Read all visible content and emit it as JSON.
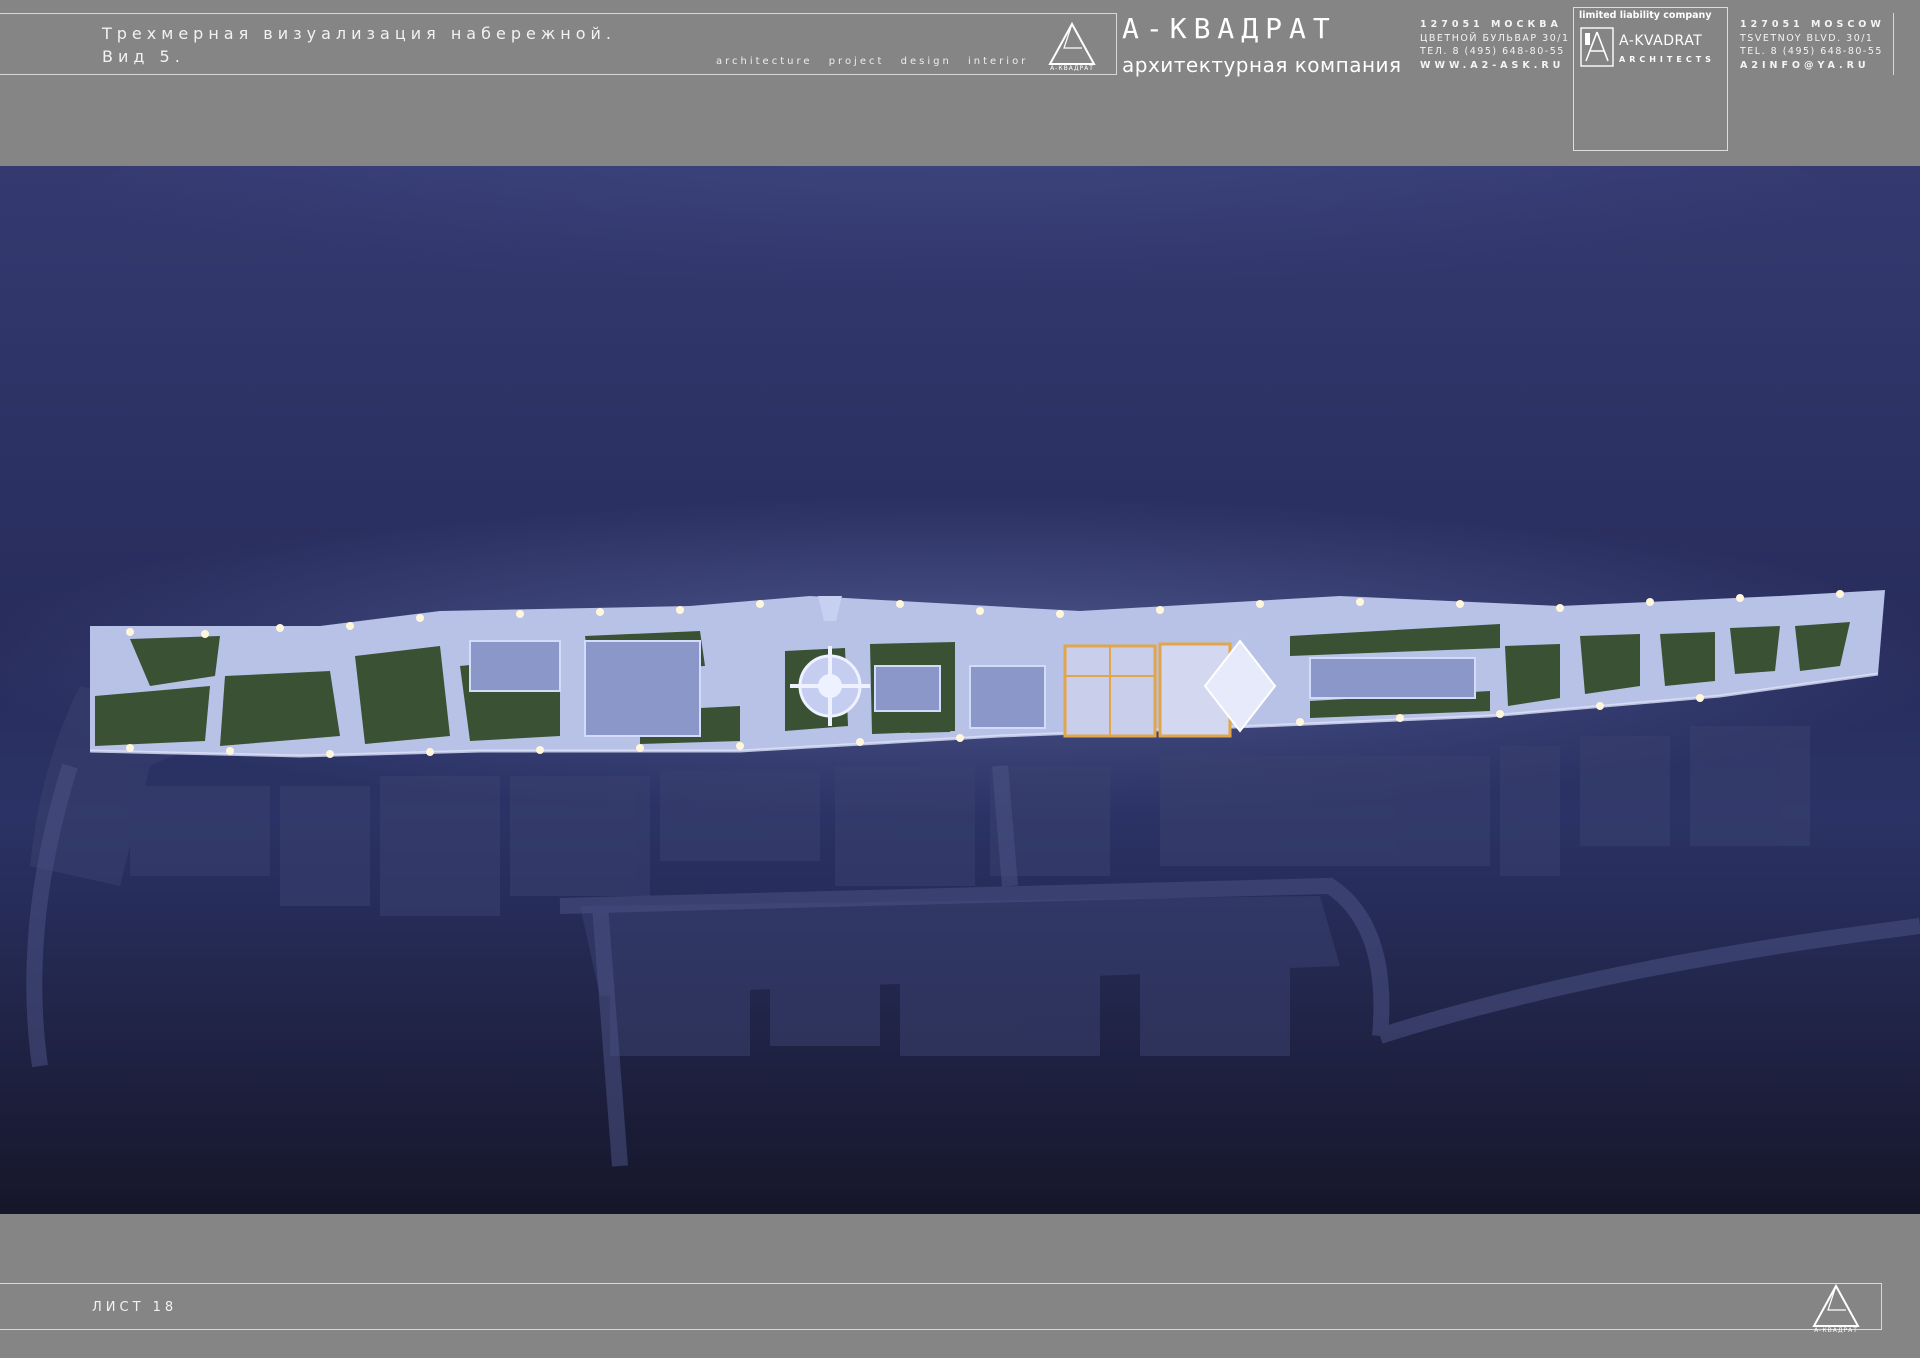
{
  "header": {
    "title_lines": [
      "Трехмерная визуализация набережной.",
      "Вид 5."
    ],
    "services": [
      "architecture",
      "project",
      "design",
      "interior"
    ],
    "logo_caption": "А-КВАДРАТ",
    "logo_icon": "triangle-logo-icon",
    "brand_name": "А-КВАДРАТ",
    "brand_subtitle": "архитектурная компания",
    "address_ru": [
      "127051 МОСКВА",
      "ЦВЕТНОЙ БУЛЬВАР 30/1",
      "ТЕЛ. 8 (495) 648-80-55",
      "WWW.A2-ASK.RU"
    ],
    "llc_label": "limited liability company",
    "llc_icon": "a-kvadrat-emblem-icon",
    "llc_name": "A-KVADRAT",
    "llc_sub": "ARCHITECTS",
    "address_en": [
      "127051 MOSCOW",
      "TSVETNOY BLVD. 30/1",
      "TEL. 8 (495) 648-80-55",
      "A2INFO@YA.RU"
    ]
  },
  "render": {
    "alt": "night aerial visualization of the embankment"
  },
  "footer": {
    "sheet_label": "ЛИСТ 18",
    "logo_caption": "А-КВАДРАТ",
    "logo_icon": "triangle-logo-icon"
  },
  "colors": {
    "page": "#858585",
    "frame": "#d8d8d8",
    "water": "#2b3366",
    "promenade": "#b9c3e6",
    "lawn": "#3b5233",
    "accent_light": "#e2a64a"
  }
}
